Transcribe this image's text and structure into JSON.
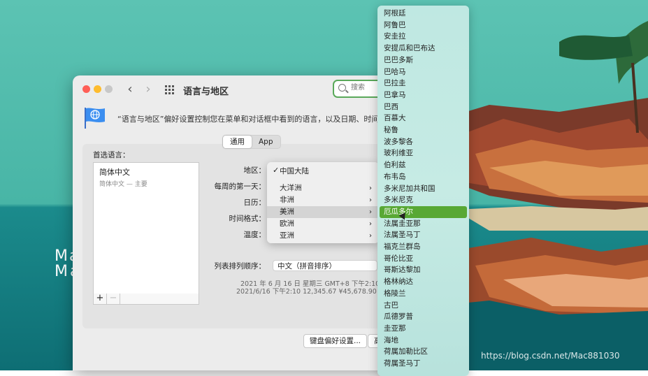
{
  "window": {
    "title": "语言与地区",
    "search_placeholder": "搜索",
    "description": "“语言与地区”偏好设置控制您在菜单和对话框中看到的语言，以及日期、时间和货币"
  },
  "tabs": [
    {
      "label": "通用",
      "active": true
    },
    {
      "label": "App",
      "active": false
    }
  ],
  "preferred": {
    "label": "首选语言：",
    "language": "简体中文",
    "language_sub": "简体中文 — 主要",
    "add_label": "+",
    "remove_label": "−"
  },
  "settings": {
    "region_label": "地区：",
    "first_day_label": "每周的第一天：",
    "calendar_label": "日历：",
    "time_format_label": "时间格式：",
    "temperature_label": "温度：",
    "sort_label": "列表排列顺序：",
    "sort_value": "中文（拼音排序）",
    "sample_line1": "2021 年 6 月 16 日 星期三 GMT+8 下午2:10:08",
    "sample_line2": "2021/6/16 下午2:10     12,345.67     ¥45,678.90"
  },
  "buttons": {
    "keyboard": "键盘偏好设置...",
    "advanced": "高"
  },
  "region_menu": {
    "checkmark": "✓",
    "selected": "中国大陆",
    "continents": [
      "大洋洲",
      "非洲",
      "美洲",
      "欧洲",
      "亚洲"
    ],
    "highlighted": "美洲",
    "arrow": "›"
  },
  "countries": [
    "阿根廷",
    "阿鲁巴",
    "安圭拉",
    "安提瓜和巴布达",
    "巴巴多斯",
    "巴哈马",
    "巴拉圭",
    "巴拿马",
    "巴西",
    "百慕大",
    "秘鲁",
    "波多黎各",
    "玻利维亚",
    "伯利兹",
    "布韦岛",
    "多米尼加共和国",
    "多米尼克",
    "厄瓜多尔",
    "法属圭亚那",
    "法属圣马丁",
    "福克兰群岛",
    "哥伦比亚",
    "哥斯达黎加",
    "格林纳达",
    "格陵兰",
    "古巴",
    "瓜德罗普",
    "圭亚那",
    "海地",
    "荷属加勒比区",
    "荷属圣马丁"
  ],
  "selected_country": "厄瓜多尔",
  "watermark": {
    "line1": "Mac",
    "line2": "Macv.com"
  },
  "footer_url": "https://blog.csdn.net/Mac881030",
  "colors": {
    "accent_green": "#58a834",
    "close": "#ff5f57",
    "minimize": "#febc2e"
  }
}
